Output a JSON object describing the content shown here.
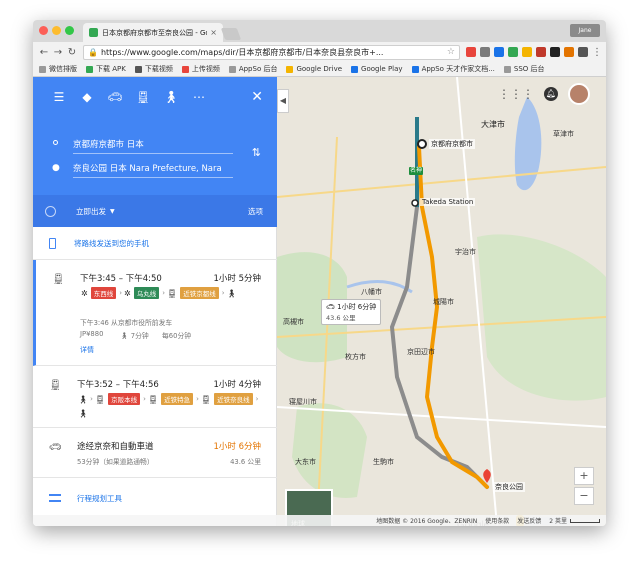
{
  "browser": {
    "tab_title": "日本京都府京都市至奈良公园 - Google",
    "tab_close": "×",
    "url": "https://www.google.com/maps/dir/日本京都府京都市/日本奈良县奈良市+...",
    "user_chip": "Jane"
  },
  "bookmarks": [
    {
      "label": "微信排版"
    },
    {
      "label": "下载 APK"
    },
    {
      "label": "下载视频"
    },
    {
      "label": "上传视频"
    },
    {
      "label": "AppSo 后台"
    },
    {
      "label": "Google Drive"
    },
    {
      "label": "Google Play"
    },
    {
      "label": "AppSo 天才作家文档..."
    },
    {
      "label": "SSO 后台"
    }
  ],
  "directions": {
    "origin": "京都府京都市 日本",
    "destination": "奈良公园 日本 Nara Prefecture, Nara",
    "depart_label": "立即出发",
    "options_label": "选项",
    "send_to_phone": "将路线发送到您的手机",
    "tools_label": "行程规划工具",
    "routes": [
      {
        "time": "下午3:45 – 下午4:50",
        "duration": "1小时 5分钟",
        "lines": [
          {
            "name": "东西线",
            "color": "#e0463c"
          },
          {
            "name": "乌丸线",
            "color": "#2e8b57"
          },
          {
            "name": "近铁京都线",
            "color": "#e0a040"
          }
        ],
        "sub": "下午3:46 从京都市役所前发车",
        "fare": "JP¥880",
        "walk": "7分钟",
        "freq": "每60分钟",
        "details": "详情"
      },
      {
        "time": "下午3:52 – 下午4:56",
        "duration": "1小时 4分钟",
        "lines": [
          {
            "name": "京阪本线",
            "color": "#e0463c"
          },
          {
            "name": "近铁特急",
            "color": "#e0a040"
          },
          {
            "name": "近铁奈良线",
            "color": "#e0a040"
          }
        ]
      },
      {
        "title": "途经京奈和自動車道",
        "duration": "1小时 6分钟",
        "sub": "53分钟（如果道路通畅）",
        "distance": "43.6 公里"
      }
    ]
  },
  "map": {
    "labels": {
      "kyoto": "京都府京都市",
      "otsu": "大津市",
      "kusatsu": "草津市",
      "takeda": "Takeda Station",
      "yawata": "八幡市",
      "takatsuki": "高槻市",
      "hirakata": "枚方市",
      "joyo": "城陽市",
      "kyotanabe": "京田辺市",
      "neyagawa": "寝屋川市",
      "daito": "大东市",
      "nara": "奈良公园",
      "ikoma": "生駒市",
      "uji": "宇治市",
      "hwy": "名神"
    },
    "bubble_duration": "1小时 6分钟",
    "bubble_distance": "43.6 公里",
    "earth_label": "地球",
    "footer": {
      "data": "地图数据 © 2016 Google、ZENRIN",
      "terms": "使用条款",
      "feedback": "发送反馈",
      "scale": "2 英里"
    }
  },
  "icons": {
    "menu": "hamburger-icon",
    "close": "close-icon",
    "swap": "swap-icon"
  }
}
